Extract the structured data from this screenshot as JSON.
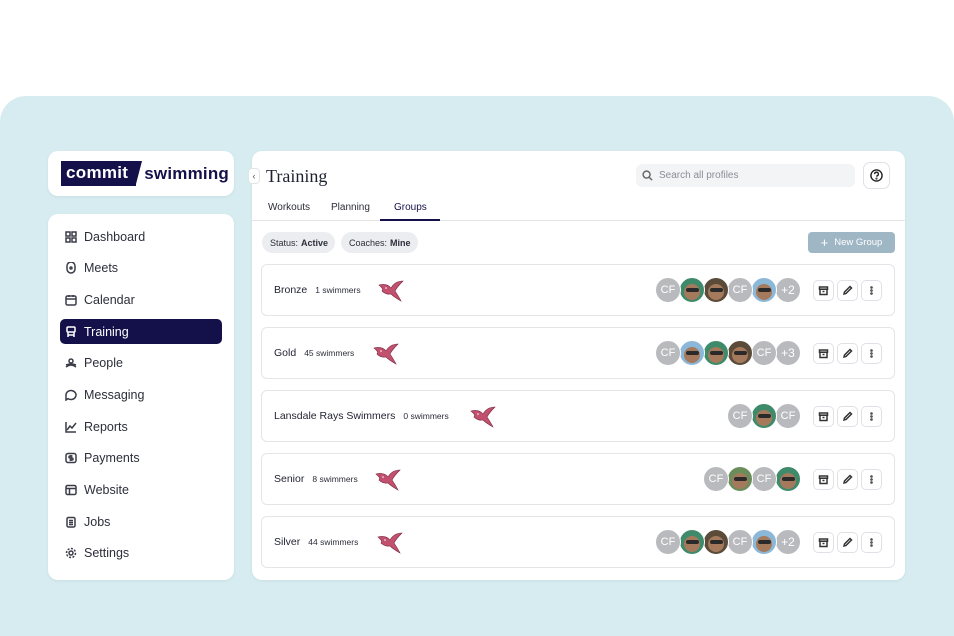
{
  "brand": {
    "commit": "commit",
    "swimming": "swimming"
  },
  "sidebar": {
    "items": [
      {
        "label": "Dashboard",
        "icon": "grid-icon"
      },
      {
        "label": "Meets",
        "icon": "meets-icon"
      },
      {
        "label": "Calendar",
        "icon": "calendar-icon"
      },
      {
        "label": "Training",
        "icon": "training-icon",
        "active": true
      },
      {
        "label": "People",
        "icon": "people-icon"
      },
      {
        "label": "Messaging",
        "icon": "chat-icon"
      },
      {
        "label": "Reports",
        "icon": "chart-icon"
      },
      {
        "label": "Payments",
        "icon": "dollar-icon"
      },
      {
        "label": "Website",
        "icon": "browser-icon"
      },
      {
        "label": "Jobs",
        "icon": "clipboard-icon"
      },
      {
        "label": "Settings",
        "icon": "gear-icon"
      }
    ]
  },
  "header": {
    "title": "Training",
    "search_placeholder": "Search all profiles"
  },
  "tabs": [
    {
      "label": "Workouts"
    },
    {
      "label": "Planning"
    },
    {
      "label": "Groups",
      "active": true
    }
  ],
  "filters": {
    "status_label": "Status:",
    "status_value": "Active",
    "coaches_label": "Coaches:",
    "coaches_value": "Mine"
  },
  "new_group_label": "New Group",
  "groups": [
    {
      "name": "Bronze",
      "count": "1 swimmers",
      "avatars": [
        "CF",
        "photo",
        "photo",
        "CF",
        "photo"
      ],
      "more": "+2"
    },
    {
      "name": "Gold",
      "count": "45 swimmers",
      "avatars": [
        "CF",
        "photo",
        "photo",
        "photo",
        "CF"
      ],
      "more": "+3"
    },
    {
      "name": "Lansdale Rays Swimmers",
      "count": "0 swimmers",
      "avatars": [
        "CF",
        "photo",
        "CF"
      ],
      "more": ""
    },
    {
      "name": "Senior",
      "count": "8 swimmers",
      "avatars": [
        "CF",
        "photo",
        "CF",
        "photo"
      ],
      "more": ""
    },
    {
      "name": "Silver",
      "count": "44 swimmers",
      "avatars": [
        "CF",
        "photo",
        "photo",
        "CF",
        "photo"
      ],
      "more": "+2"
    }
  ],
  "colors": {
    "navy": "#14114a",
    "ray": "#c2506f",
    "stage": "#d6ecf0",
    "new_group": "#9fb6c5"
  }
}
